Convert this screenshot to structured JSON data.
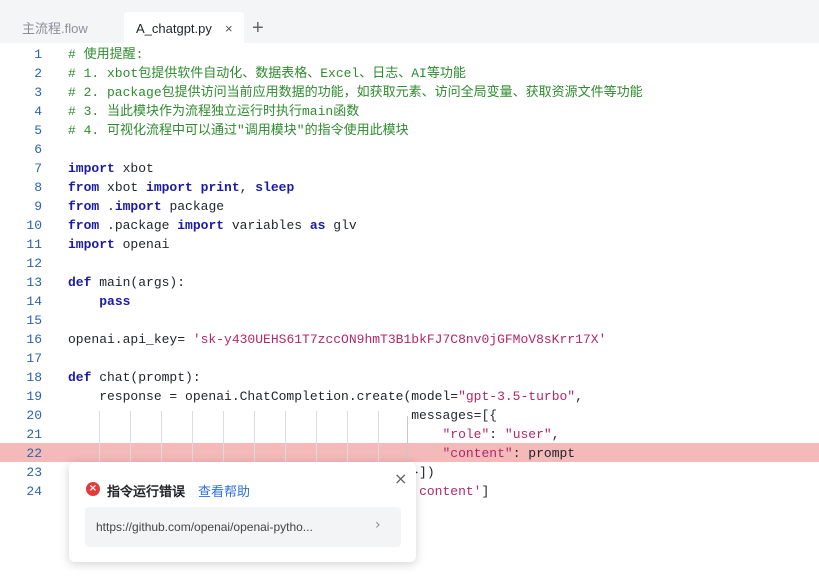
{
  "tabs": [
    {
      "label": "主流程.flow"
    },
    {
      "label": "A_chatgpt.py"
    }
  ],
  "tab_close_glyph": "×",
  "add_tab_glyph": "+",
  "code": {
    "highlighted_line": 22,
    "lines": [
      {
        "n": "1",
        "parts": [
          {
            "t": "# 使用提醒:",
            "c": "cm"
          }
        ]
      },
      {
        "n": "2",
        "parts": [
          {
            "t": "# 1. xbot包提供软件自动化、数据表格、Excel、日志、AI等功能",
            "c": "cm"
          }
        ]
      },
      {
        "n": "3",
        "parts": [
          {
            "t": "# 2. package包提供访问当前应用数据的功能，如获取元素、访问全局变量、获取资源文件等功能",
            "c": "cm"
          }
        ]
      },
      {
        "n": "4",
        "parts": [
          {
            "t": "# 3. 当此模块作为流程独立运行时执行main函数",
            "c": "cm"
          }
        ]
      },
      {
        "n": "5",
        "parts": [
          {
            "t": "# 4. 可视化流程中可以通过\"调用模块\"的指令使用此模块",
            "c": "cm"
          }
        ]
      },
      {
        "n": "6",
        "parts": []
      },
      {
        "n": "7",
        "parts": [
          {
            "t": "import",
            "c": "kw"
          },
          {
            "t": " xbot",
            "c": ""
          }
        ]
      },
      {
        "n": "8",
        "parts": [
          {
            "t": "from",
            "c": "kw"
          },
          {
            "t": " xbot ",
            "c": ""
          },
          {
            "t": "import",
            "c": "kw"
          },
          {
            "t": " ",
            "c": ""
          },
          {
            "t": "print",
            "c": "kw"
          },
          {
            "t": ", ",
            "c": ""
          },
          {
            "t": "sleep",
            "c": "kw"
          }
        ]
      },
      {
        "n": "9",
        "parts": [
          {
            "t": "from",
            "c": "kw"
          },
          {
            "t": " .",
            "c": ""
          },
          {
            "t": "import",
            "c": "kw"
          },
          {
            "t": " package",
            "c": ""
          }
        ]
      },
      {
        "n": "10",
        "parts": [
          {
            "t": "from",
            "c": "kw"
          },
          {
            "t": " .package ",
            "c": ""
          },
          {
            "t": "import",
            "c": "kw"
          },
          {
            "t": " variables ",
            "c": ""
          },
          {
            "t": "as",
            "c": "kw"
          },
          {
            "t": " glv",
            "c": ""
          }
        ]
      },
      {
        "n": "11",
        "parts": [
          {
            "t": "import",
            "c": "kw"
          },
          {
            "t": " openai",
            "c": ""
          }
        ]
      },
      {
        "n": "12",
        "parts": []
      },
      {
        "n": "13",
        "parts": [
          {
            "t": "def",
            "c": "kw"
          },
          {
            "t": " main(args):",
            "c": ""
          }
        ]
      },
      {
        "n": "14",
        "parts": [
          {
            "t": "    ",
            "c": ""
          },
          {
            "t": "pass",
            "c": "kw"
          }
        ]
      },
      {
        "n": "15",
        "parts": []
      },
      {
        "n": "16",
        "parts": [
          {
            "t": "openai.api_key= ",
            "c": ""
          },
          {
            "t": "'sk-y430UEHS61T7zccON9hmT3B1bkFJ7C8nv0jGFMoV8sKrr17X'",
            "c": "st"
          }
        ]
      },
      {
        "n": "17",
        "parts": []
      },
      {
        "n": "18",
        "parts": [
          {
            "t": "def",
            "c": "kw"
          },
          {
            "t": " chat(prompt):",
            "c": ""
          }
        ]
      },
      {
        "n": "19",
        "parts": [
          {
            "t": "    response = openai.ChatCompletion.create(model=",
            "c": ""
          },
          {
            "t": "\"gpt-3.5-turbo\"",
            "c": "st"
          },
          {
            "t": ",",
            "c": ""
          }
        ]
      },
      {
        "n": "20",
        "parts": [
          {
            "t": "                                            messages=[{",
            "c": ""
          }
        ]
      },
      {
        "n": "21",
        "parts": [
          {
            "t": "                                                ",
            "c": ""
          },
          {
            "t": "\"role\"",
            "c": "st"
          },
          {
            "t": ": ",
            "c": ""
          },
          {
            "t": "\"user\"",
            "c": "st"
          },
          {
            "t": ",",
            "c": ""
          }
        ]
      },
      {
        "n": "22",
        "parts": [
          {
            "t": "                                                ",
            "c": ""
          },
          {
            "t": "\"content\"",
            "c": "st"
          },
          {
            "t": ": prompt",
            "c": ""
          }
        ]
      },
      {
        "n": "23",
        "parts": [
          {
            "t": "                                            }])",
            "c": ""
          }
        ]
      },
      {
        "n": "24",
        "parts": [
          {
            "t": "                                            ",
            "c": ""
          },
          {
            "t": "'content'",
            "c": "st"
          },
          {
            "t": "]",
            "c": ""
          }
        ]
      }
    ]
  },
  "error_popup": {
    "title": "指令运行错误",
    "help_link": "查看帮助",
    "close_glyph": "×",
    "url": "https://github.com/openai/openai-pytho...",
    "arrow_glyph": "›",
    "icon_glyph": "×"
  },
  "colors": {
    "comment": "#2e8b2e",
    "keyword": "#1a1aa6",
    "string": "#b4266b",
    "line_number": "#2a64a8",
    "error_line_bg": "#f4b9b9",
    "error_icon": "#e23b3b",
    "link": "#2f6fe0"
  }
}
